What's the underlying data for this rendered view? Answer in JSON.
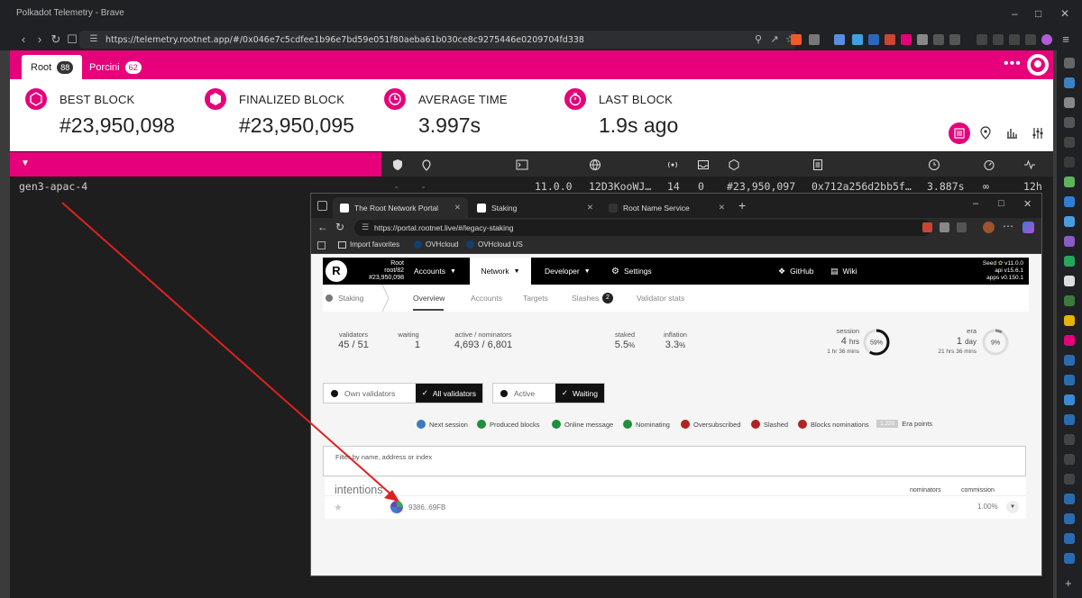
{
  "brave": {
    "window_title": "Polkadot Telemetry - Brave",
    "url": "https://telemetry.rootnet.app/#/0x046e7c5cdfee1b96e7bd59e051f80aeba61b030ce8c9275446e0209704fd338"
  },
  "telemetry": {
    "tabs": [
      {
        "label": "Root",
        "count": "88"
      },
      {
        "label": "Porcini",
        "count": "62"
      }
    ],
    "stats": [
      {
        "label": "BEST BLOCK",
        "value": "#23,950,098",
        "icon": "cube-icon"
      },
      {
        "label": "FINALIZED BLOCK",
        "value": "#23,950,095",
        "icon": "cube-filled-icon"
      },
      {
        "label": "AVERAGE TIME",
        "value": "3.997s",
        "icon": "clock-icon"
      },
      {
        "label": "LAST BLOCK",
        "value": "1.9s ago",
        "icon": "stopwatch-icon"
      }
    ],
    "node": {
      "name": "gen3-apac-4",
      "col1": "-",
      "col2": "-",
      "version": "11.0.0",
      "network_id": "12D3KooWJ…",
      "peers": "14",
      "txs": "0",
      "block": "#23,950,097",
      "hash": "0x712a256d2bb5f…",
      "block_time": "3.887s",
      "propagation": "∞",
      "uptime": "12h"
    }
  },
  "edge": {
    "tabs": [
      {
        "label": "The Root Network Portal"
      },
      {
        "label": "Staking"
      },
      {
        "label": "Root Name Service"
      }
    ],
    "url": "https://portal.rootnet.live/#/legacy-staking",
    "favorites": [
      {
        "label": "Import favorites"
      },
      {
        "label": "OVHcloud"
      },
      {
        "label": "OVHcloud US"
      }
    ]
  },
  "portal": {
    "chain_name": "Root",
    "chain_sub": "root/82",
    "chain_block": "#23,950,098",
    "nav": {
      "accounts": "Accounts",
      "network": "Network",
      "developer": "Developer",
      "settings": "Settings",
      "github": "GitHub",
      "wiki": "Wiki"
    },
    "versions": {
      "seed": "Seed",
      "seed_version": "v11.0.0",
      "api": "api v15.6.1",
      "apps": "apps v0.150.1"
    },
    "subnav": {
      "staking": "Staking",
      "overview": "Overview",
      "accounts": "Accounts",
      "targets": "Targets",
      "slashes": "Slashes",
      "slashes_count": "2",
      "validator_stats": "Validator stats"
    },
    "summary": {
      "validators_label": "validators",
      "validators_value": "45 / 51",
      "waiting_label": "waiting",
      "waiting_value": "1",
      "active_label": "active / nominators",
      "active_value": "4,693 / 6,801",
      "staked_label": "staked",
      "staked_value": "5.5",
      "staked_unit": "%",
      "inflation_label": "inflation",
      "inflation_value": "3.3",
      "inflation_unit": "%",
      "session_label": "session",
      "session_value": "4",
      "session_unit": "hrs",
      "session_sub": "1 hr 36 mins",
      "session_pct": "59%",
      "session_fraction": 0.59,
      "era_label": "era",
      "era_value": "1",
      "era_unit": "day",
      "era_sub": "21 hrs 36 mins",
      "era_pct": "9%",
      "era_fraction": 0.09
    },
    "toggles": {
      "own": "Own validators",
      "all": "All validators",
      "active": "Active",
      "waiting": "Waiting"
    },
    "legend": [
      {
        "label": "Next session",
        "color": "#3b7bbf"
      },
      {
        "label": "Produced blocks",
        "color": "#1e8f3c"
      },
      {
        "label": "Online message",
        "color": "#1e8f3c"
      },
      {
        "label": "Nominating",
        "color": "#1e8f3c"
      },
      {
        "label": "Oversubscribed",
        "color": "#b22222"
      },
      {
        "label": "Slashed",
        "color": "#b22222"
      },
      {
        "label": "Blocks nominations",
        "color": "#b22222"
      }
    ],
    "era_points_badge": "1,220",
    "era_points_label": "Era points",
    "filter_placeholder": "Filter by name, address or index",
    "intentions": {
      "title": "intentions",
      "col_nominators": "nominators",
      "col_commission": "commission",
      "row_address": "9386..69FB",
      "row_commission": "1.00%"
    }
  }
}
